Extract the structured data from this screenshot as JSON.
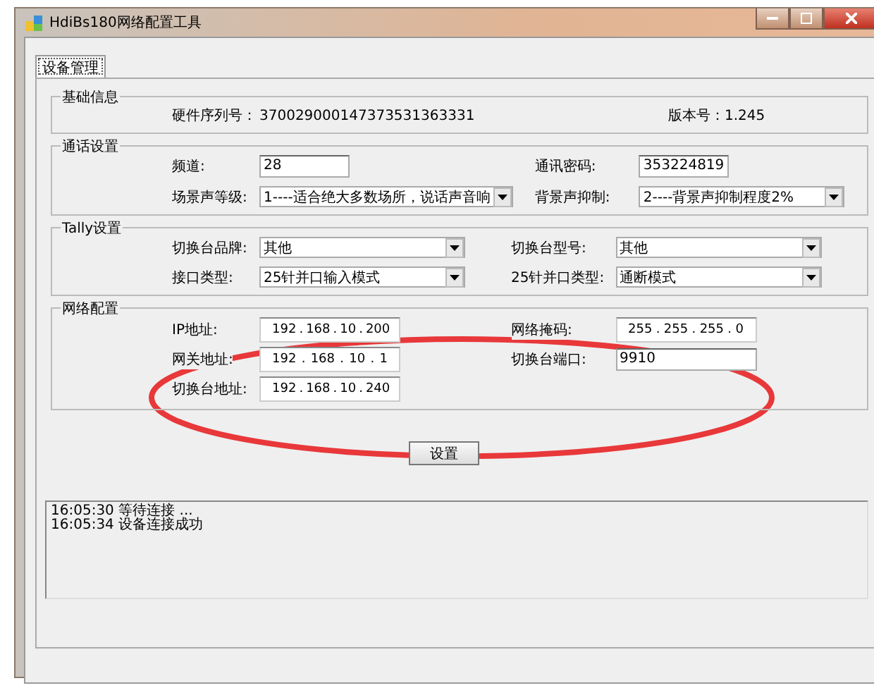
{
  "window": {
    "title": "HdiBs180网络配置工具"
  },
  "tabs": [
    {
      "label": "设备管理",
      "selected": true
    }
  ],
  "groups": [
    {
      "title": "基础信息",
      "rows": [
        [
          {
            "label": "硬件序列号：",
            "kind": "value",
            "value": "370029000147373531363331"
          },
          {
            "label": "版本号：",
            "kind": "value",
            "value": "1.245"
          }
        ]
      ]
    },
    {
      "title": "通话设置",
      "rows": [
        [
          {
            "label": "频道:",
            "kind": "text",
            "value": "28"
          },
          {
            "label": "通讯密码:",
            "kind": "text",
            "value": "353224819"
          }
        ],
        [
          {
            "label": "场景声等级:",
            "kind": "combo",
            "value": "1----适合绝大多数场所，说话声音响"
          },
          {
            "label": "背景声抑制:",
            "kind": "combo",
            "value": "2----背景声抑制程度2%"
          }
        ]
      ]
    },
    {
      "title": "Tally设置",
      "rows": [
        [
          {
            "label": "切换台品牌:",
            "kind": "combo",
            "value": "其他"
          },
          {
            "label": "切换台型号:",
            "kind": "combo",
            "value": "其他"
          }
        ],
        [
          {
            "label": "接口类型:",
            "kind": "combo",
            "value": "25针并口输入模式"
          },
          {
            "label": "25针并口类型:",
            "kind": "combo",
            "value": "通断模式"
          }
        ]
      ]
    },
    {
      "title": "网络配置",
      "rows": [
        [
          {
            "label": "IP地址:",
            "kind": "ip",
            "octets": [
              "192",
              "168",
              "10",
              "200"
            ],
            "separator": "."
          },
          {
            "label": "网络掩码:",
            "kind": "ip",
            "octets": [
              "255",
              "255",
              "255",
              "0"
            ],
            "separator": "."
          }
        ],
        [
          {
            "label": "网关地址:",
            "kind": "ip",
            "octets": [
              "192",
              "168",
              "10",
              "1"
            ],
            "separator": "."
          },
          {
            "label": "切换台端口:",
            "kind": "text",
            "value": "9910"
          }
        ],
        [
          {
            "label": "切换台地址:",
            "kind": "ip",
            "octets": [
              "192",
              "168",
              "10",
              "240"
            ],
            "separator": "."
          }
        ]
      ]
    }
  ],
  "button": "设置",
  "log": [
    {
      "time": "16:05:30",
      "message": "等待连接 ..."
    },
    {
      "time": "16:05:34",
      "message": "设备连接成功"
    }
  ],
  "annotation": {
    "kind": "ellipse"
  }
}
